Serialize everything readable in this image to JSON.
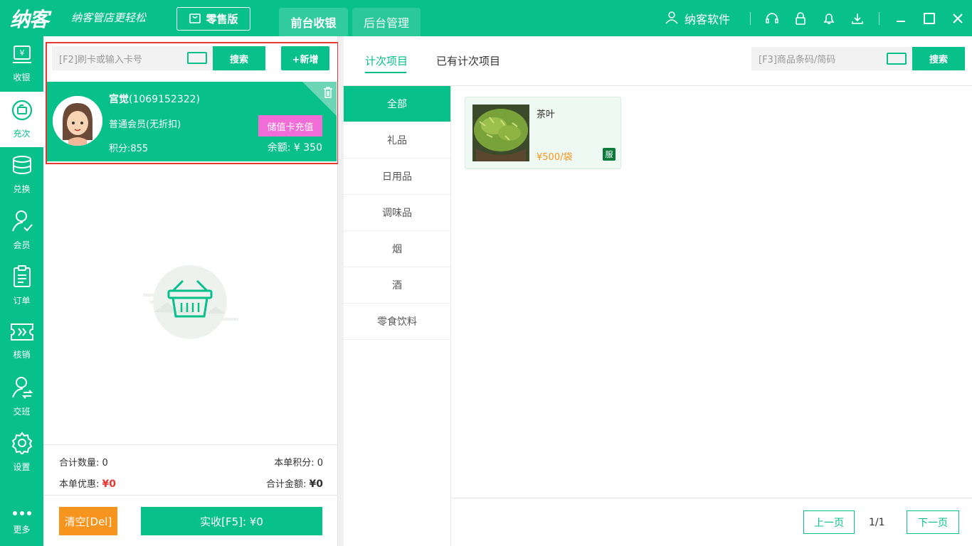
{
  "header": {
    "logo": "纳客",
    "slogan": "纳客管店更轻松",
    "edition_label": "零售版",
    "tabs": [
      {
        "label": "前台收银",
        "active": true
      },
      {
        "label": "后台管理",
        "active": false
      }
    ],
    "user_name": "纳客软件"
  },
  "sidebar": {
    "items": [
      {
        "label": "收银",
        "icon": "cashier-icon"
      },
      {
        "label": "充次",
        "icon": "recharge-icon",
        "active": true
      },
      {
        "label": "兑换",
        "icon": "exchange-icon"
      },
      {
        "label": "会员",
        "icon": "member-icon"
      },
      {
        "label": "订单",
        "icon": "order-icon"
      },
      {
        "label": "核销",
        "icon": "ticket-icon"
      },
      {
        "label": "交班",
        "icon": "shift-icon"
      },
      {
        "label": "设置",
        "icon": "gear-icon"
      },
      {
        "label": "更多",
        "icon": "more-icon"
      }
    ]
  },
  "left": {
    "card_placeholder": "[F2]刷卡或输入卡号",
    "search_label": "搜索",
    "add_label": "+新增",
    "member": {
      "name": "宫觉",
      "card_no": "(1069152322)",
      "level": "普通会员(无折扣)",
      "recharge_label": "储值卡充值",
      "points": "积分:855",
      "balance": "余额: ¥ 350"
    },
    "totals": {
      "qty_label": "合计数量:",
      "qty_value": "0",
      "points_label": "本单积分:",
      "points_value": "0",
      "discount_label": "本单优惠:",
      "discount_value": "¥0",
      "amount_label": "合计金额:",
      "amount_value": "¥0"
    },
    "clear_label": "清空[Del]",
    "pay_label": "实收[F5]: ¥0"
  },
  "right": {
    "tabs": [
      {
        "label": "计次项目",
        "active": true
      },
      {
        "label": "已有计次项目",
        "active": false
      }
    ],
    "barcode_placeholder": "[F3]商品条码/简码",
    "search_label": "搜索",
    "categories": [
      "全部",
      "礼品",
      "日用品",
      "调味品",
      "烟",
      "酒",
      "零食饮料"
    ],
    "products": [
      {
        "name": "茶叶",
        "price": "¥500/袋",
        "badge": "服"
      }
    ],
    "pager": {
      "prev_label": "上一页",
      "page": "1/1",
      "next_label": "下一页"
    }
  },
  "colors": {
    "brand": "#07c08a",
    "pink": "#f26cd7",
    "orange": "#f7941d",
    "red": "#e53935"
  }
}
